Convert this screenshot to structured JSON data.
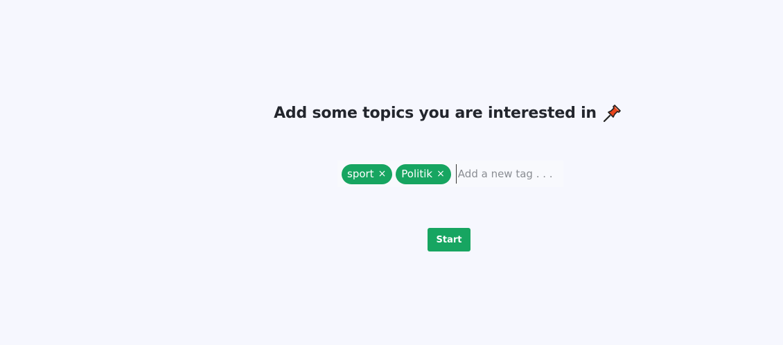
{
  "heading": {
    "text": "Add some topics you are interested in",
    "icon": "pushpin-icon"
  },
  "tags": [
    {
      "label": "sport",
      "remove": "×"
    },
    {
      "label": "Politik",
      "remove": "×"
    }
  ],
  "tag_input": {
    "value": "",
    "placeholder": "Add a new tag . . ."
  },
  "start_button": {
    "label": "Start"
  },
  "colors": {
    "accent": "#17a561",
    "background": "#f6f7fe",
    "heading": "#23262d",
    "pin": "#e8451c"
  }
}
